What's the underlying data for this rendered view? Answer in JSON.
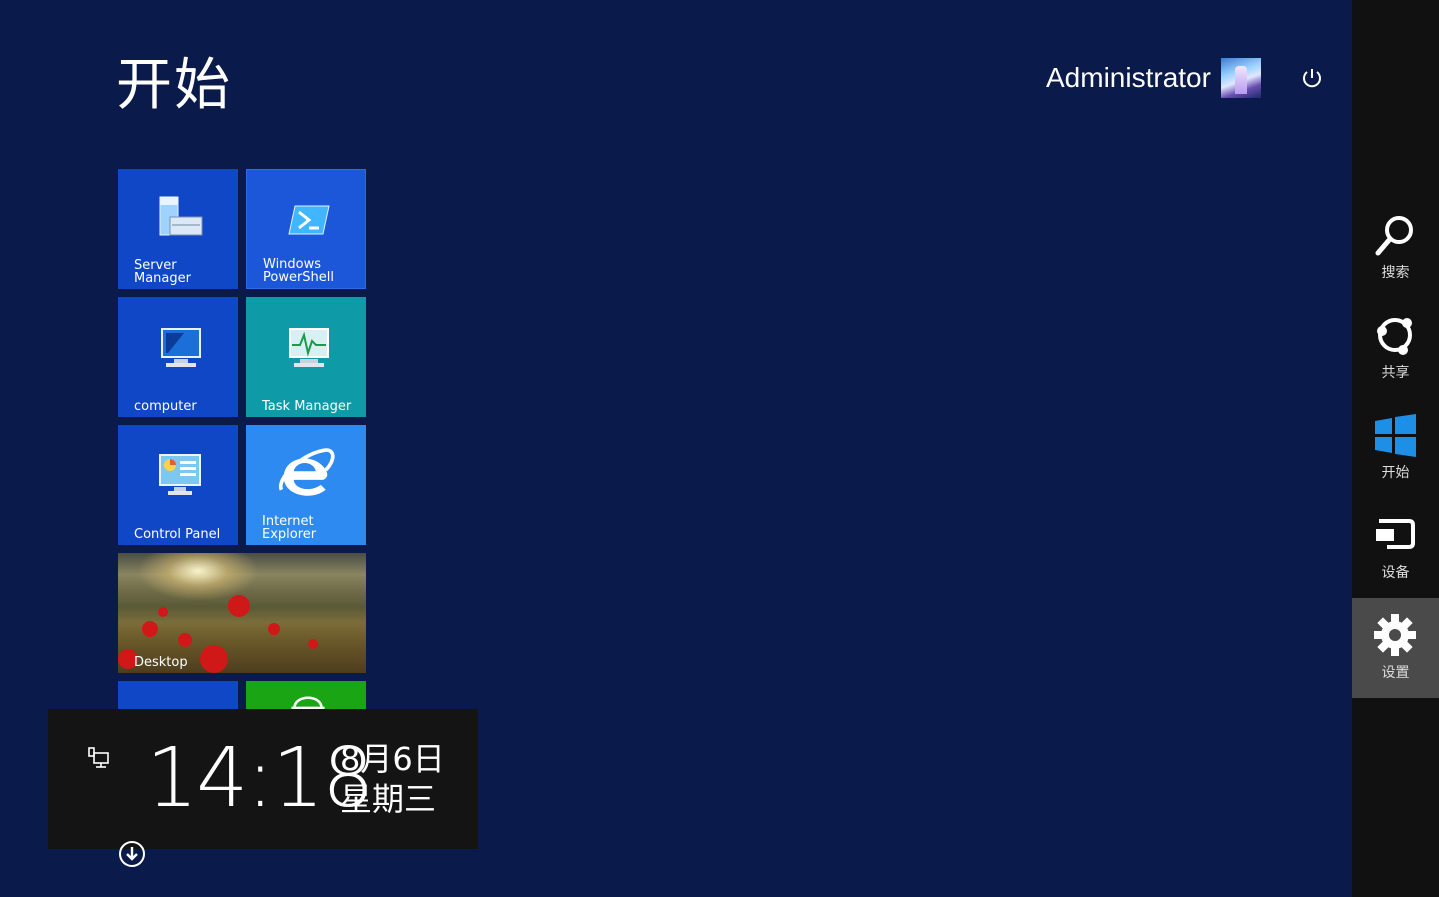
{
  "header": {
    "title": "开始",
    "user_name": "Administrator",
    "power_icon": "power-icon"
  },
  "tiles": [
    {
      "label": "Server Manager",
      "color": "#1047c6",
      "icon": "server-manager-icon"
    },
    {
      "label": "Windows\nPowerShell",
      "color": "#1c56d9",
      "icon": "powershell-icon"
    },
    {
      "label": "computer",
      "color": "#1047c6",
      "icon": "computer-icon"
    },
    {
      "label": "Task Manager",
      "color": "#0e9aa6",
      "icon": "task-manager-icon"
    },
    {
      "label": "Control Panel",
      "color": "#1047c6",
      "icon": "control-panel-icon"
    },
    {
      "label": "Internet\nExplorer",
      "color": "#2d8af0",
      "icon": "internet-explorer-icon"
    },
    {
      "label": "Desktop",
      "icon": "desktop-wallpaper"
    }
  ],
  "clock": {
    "time": "14:18",
    "date": "8月6日",
    "weekday": "星期三",
    "network_icon": "network-icon"
  },
  "charms": [
    {
      "label": "搜索",
      "icon": "search-icon"
    },
    {
      "label": "共享",
      "icon": "share-icon"
    },
    {
      "label": "开始",
      "icon": "windows-start-icon"
    },
    {
      "label": "设备",
      "icon": "devices-icon"
    },
    {
      "label": "设置",
      "icon": "settings-gear-icon",
      "active": true
    }
  ],
  "colors": {
    "background": "#0a1a4a",
    "charm_bar": "#111111",
    "charm_active": "#4a4a4a"
  }
}
